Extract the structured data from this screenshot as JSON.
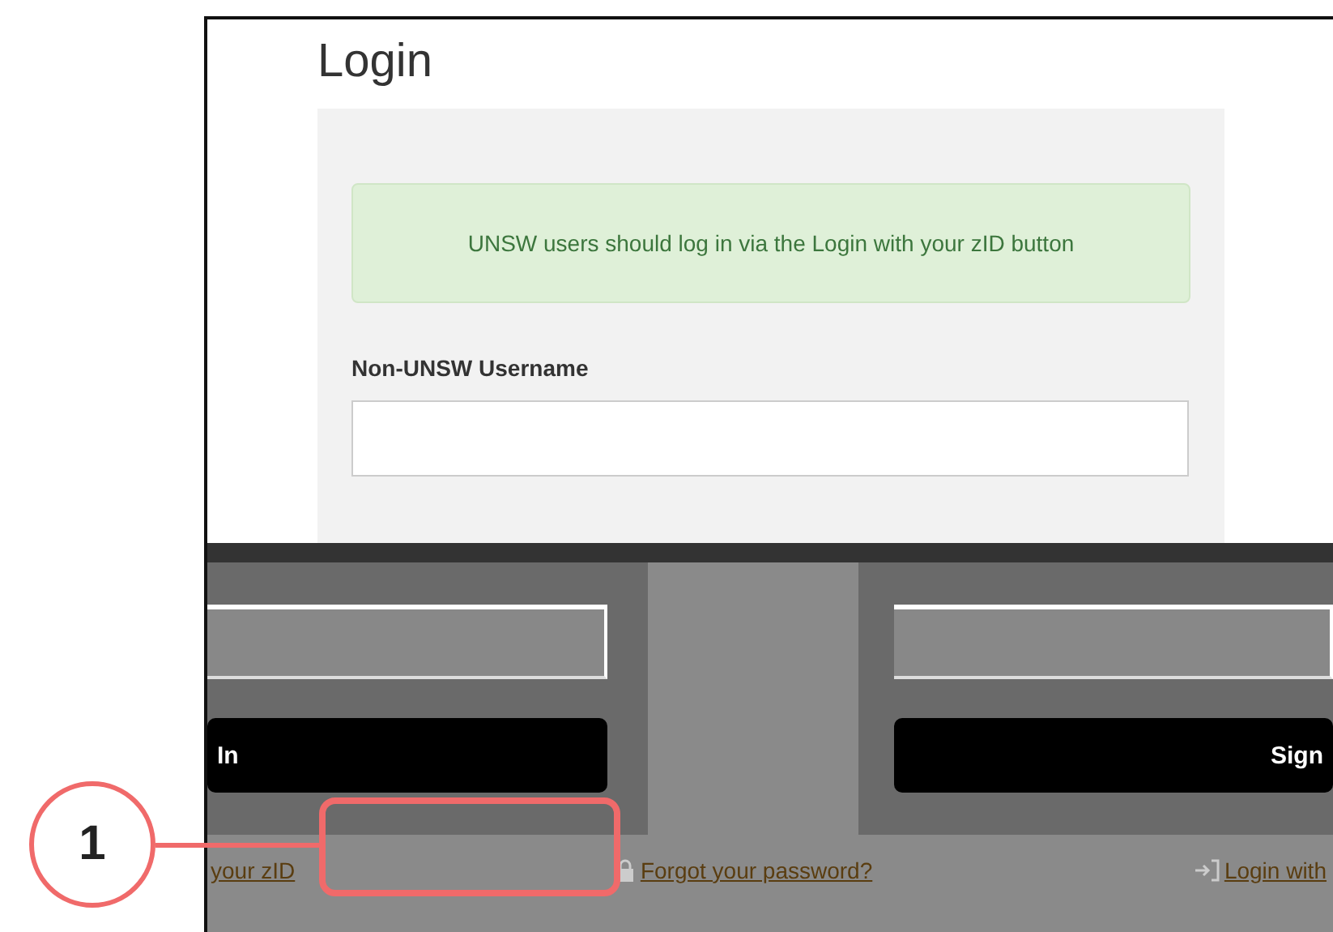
{
  "page": {
    "title": "Login"
  },
  "form": {
    "notice": "UNSW users should log in via the Login with your zID button",
    "username_label": "Non-UNSW Username"
  },
  "lower_section": {
    "buttons": [
      "In",
      "Sign"
    ],
    "links": [
      {
        "kind": "plain",
        "label": "your zID"
      },
      {
        "kind": "lock",
        "label": "Forgot your password?"
      },
      {
        "kind": "login",
        "label": "Login with"
      }
    ]
  },
  "callout": {
    "number": "1"
  }
}
